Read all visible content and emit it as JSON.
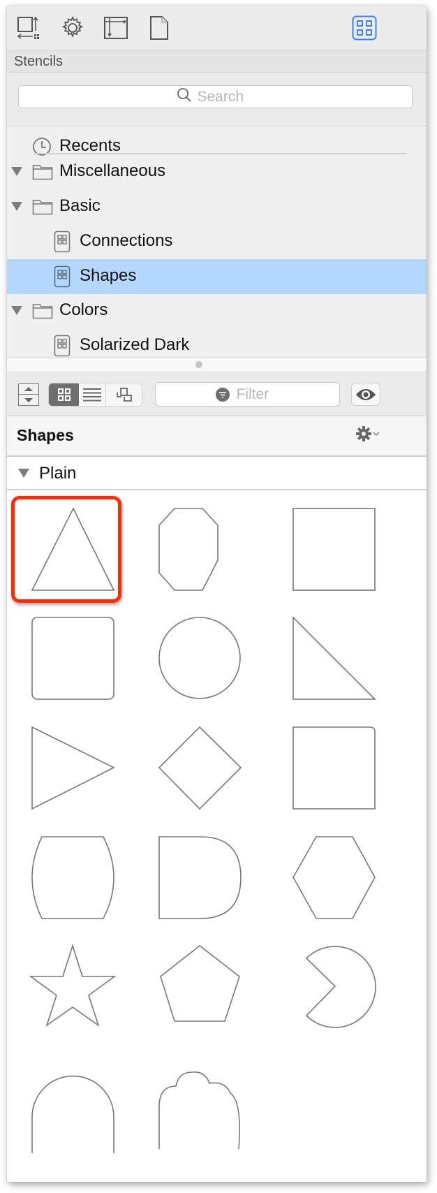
{
  "toolbar": {
    "icons": [
      {
        "name": "canvas-size-icon",
        "label": "Canvas"
      },
      {
        "name": "gear-icon",
        "label": "Settings"
      },
      {
        "name": "layout-icon",
        "label": "Layout"
      },
      {
        "name": "document-icon",
        "label": "Document"
      },
      {
        "name": "stencils-grid-icon",
        "label": "Stencils",
        "active": true
      }
    ],
    "active_color": "#3b82f6"
  },
  "stencils_header": {
    "title": "Stencils"
  },
  "search": {
    "placeholder": "Search",
    "value": ""
  },
  "source_list": {
    "items": [
      {
        "label": "Recents",
        "icon": "clock-icon",
        "indent": 0,
        "disclosure": false
      },
      {
        "label": "Miscellaneous",
        "icon": "folder-icon",
        "indent": 0,
        "disclosure": true
      },
      {
        "label": "Basic",
        "icon": "folder-icon",
        "indent": 0,
        "disclosure": true
      },
      {
        "label": "Connections",
        "icon": "stencil-icon",
        "indent": 1,
        "disclosure": false
      },
      {
        "label": "Shapes",
        "icon": "stencil-icon",
        "indent": 1,
        "disclosure": false,
        "selected": true
      },
      {
        "label": "Colors",
        "icon": "folder-icon",
        "indent": 0,
        "disclosure": true
      },
      {
        "label": "Solarized Dark",
        "icon": "stencil-icon",
        "indent": 1,
        "disclosure": false
      }
    ],
    "selected_color": "#b3d7ff"
  },
  "view_bar": {
    "view_modes": [
      "grid",
      "list",
      "outline"
    ],
    "active_view": "grid",
    "filter": {
      "placeholder": "Filter",
      "value": ""
    }
  },
  "stencil": {
    "title": "Shapes",
    "group": {
      "label": "Plain",
      "expanded": true
    },
    "shapes": [
      {
        "name": "triangle",
        "selected": true
      },
      {
        "name": "octagon"
      },
      {
        "name": "square"
      },
      {
        "name": "rounded-rectangle"
      },
      {
        "name": "circle"
      },
      {
        "name": "right-triangle"
      },
      {
        "name": "triangle-right"
      },
      {
        "name": "diamond"
      },
      {
        "name": "rounded-corner-square"
      },
      {
        "name": "barrel"
      },
      {
        "name": "d-shape"
      },
      {
        "name": "hexagon"
      },
      {
        "name": "star"
      },
      {
        "name": "pentagon"
      },
      {
        "name": "pac-man"
      },
      {
        "name": "semi-circle"
      },
      {
        "name": "cloud"
      }
    ],
    "selection_color": "#ff2a00"
  }
}
